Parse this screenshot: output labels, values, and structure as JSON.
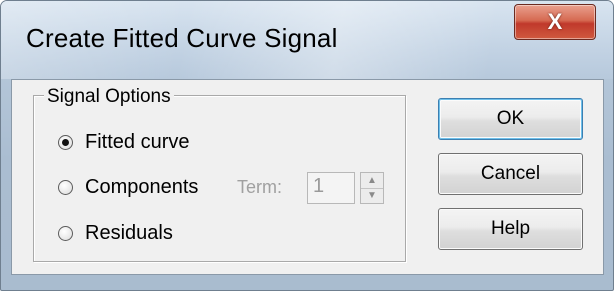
{
  "window": {
    "title": "Create Fitted Curve Signal",
    "close_glyph": "X"
  },
  "signal_options": {
    "label": "Signal Options",
    "options": [
      {
        "label": "Fitted curve",
        "checked": true
      },
      {
        "label": "Components",
        "checked": false
      },
      {
        "label": "Residuals",
        "checked": false
      }
    ],
    "term": {
      "label": "Term:",
      "value": "1",
      "enabled": false
    }
  },
  "buttons": {
    "ok": "OK",
    "cancel": "Cancel",
    "help": "Help"
  },
  "icons": {
    "close": "close-icon",
    "spin_up": "arrow-up-icon",
    "spin_down": "arrow-down-icon"
  },
  "colors": {
    "close_button": "#c0392b",
    "default_button_border": "#3c7fb1",
    "dialog_face": "#f0f0f0"
  }
}
